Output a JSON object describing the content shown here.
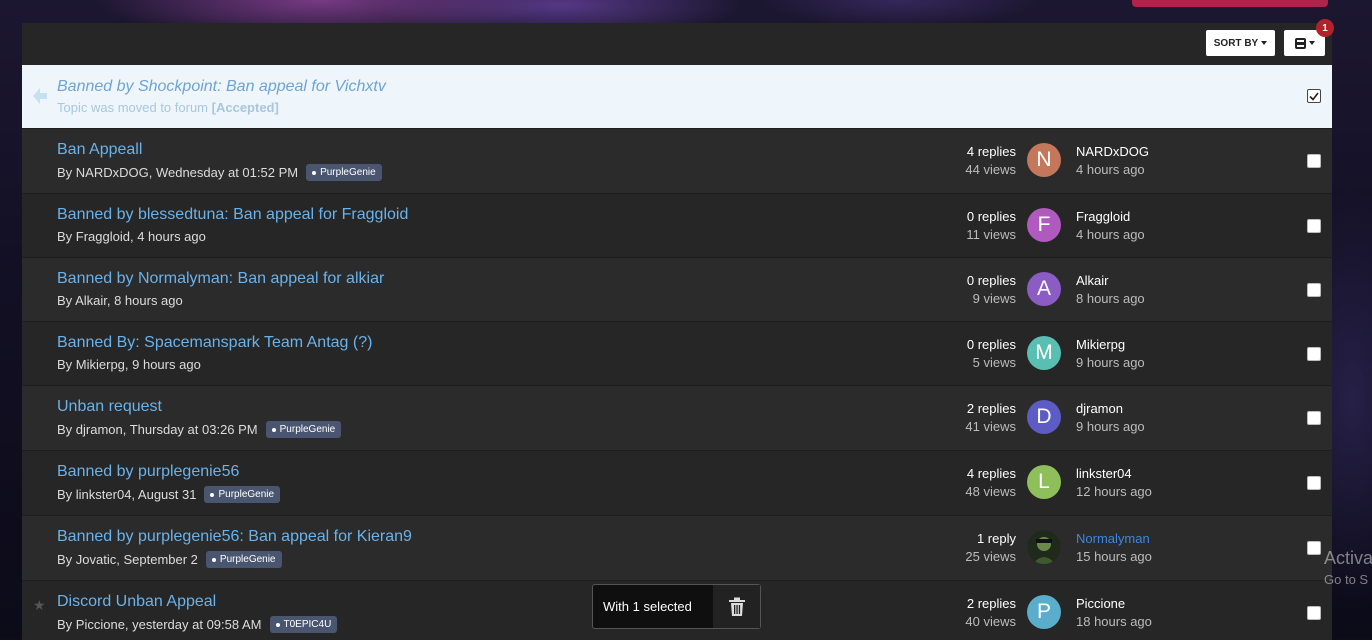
{
  "toolbar": {
    "sort_label": "SORT BY",
    "mod_badge_count": "1"
  },
  "moved_topic": {
    "title": "Banned by Shockpoint: Ban appeal for Vichxtv",
    "subtitle_prefix": "Topic was moved to forum",
    "forum": "[Accepted]",
    "checked": true
  },
  "topics": [
    {
      "title": "Ban Appeall",
      "author": "By NARDxDOG, Wednesday at 01:52 PM",
      "tag": "PurpleGenie",
      "replies": "4 replies",
      "views": "44 views",
      "last_user": "NARDxDOG",
      "last_time": "4 hours ago",
      "avatar_letter": "N",
      "avatar_color": "#c4775a"
    },
    {
      "title": "Banned by blessedtuna: Ban appeal for Fraggloid",
      "author": "By Fraggloid, 4 hours ago",
      "tag": "",
      "replies": "0 replies",
      "views": "11 views",
      "last_user": "Fraggloid",
      "last_time": "4 hours ago",
      "avatar_letter": "F",
      "avatar_color": "#b05ac0"
    },
    {
      "title": "Banned by Normalyman: Ban appeal for alkiar",
      "author": "By Alkair, 8 hours ago",
      "tag": "",
      "replies": "0 replies",
      "views": "9 views",
      "last_user": "Alkair",
      "last_time": "8 hours ago",
      "avatar_letter": "A",
      "avatar_color": "#8a5cc4"
    },
    {
      "title": "Banned By: Spacemanspark Team Antag (?)",
      "author": "By Mikierpg, 9 hours ago",
      "tag": "",
      "replies": "0 replies",
      "views": "5 views",
      "last_user": "Mikierpg",
      "last_time": "9 hours ago",
      "avatar_letter": "M",
      "avatar_color": "#5abfb3"
    },
    {
      "title": "Unban request",
      "author": "By djramon, Thursday at 03:26 PM",
      "tag": "PurpleGenie",
      "replies": "2 replies",
      "views": "41 views",
      "last_user": "djramon",
      "last_time": "9 hours ago",
      "avatar_letter": "D",
      "avatar_color": "#5c5cc4"
    },
    {
      "title": "Banned by purplegenie56",
      "author": "By linkster04, August 31",
      "tag": "PurpleGenie",
      "replies": "4 replies",
      "views": "48 views",
      "last_user": "linkster04",
      "last_time": "12 hours ago",
      "avatar_letter": "L",
      "avatar_color": "#8fbf5a"
    },
    {
      "title": "Banned by purplegenie56: Ban appeal for Kieran9",
      "author": "By Jovatic, September 2",
      "tag": "PurpleGenie",
      "replies": "1 reply",
      "views": "25 views",
      "last_user": "Normalyman",
      "last_time": "15 hours ago",
      "avatar_letter": "",
      "avatar_color": "#2e3a2a",
      "link_user": true
    },
    {
      "title": "Discord Unban Appeal",
      "author": "By Piccione, yesterday at 09:58 AM",
      "tag": "T0EPIC4U",
      "replies": "2 replies",
      "views": "40 views",
      "last_user": "Piccione",
      "last_time": "18 hours ago",
      "avatar_letter": "P",
      "avatar_color": "#5aaecc",
      "starred": true
    }
  ],
  "selection_bar": {
    "text": "With 1 selected"
  },
  "watermark": {
    "line1": "Activa",
    "line2": "Go to S"
  }
}
